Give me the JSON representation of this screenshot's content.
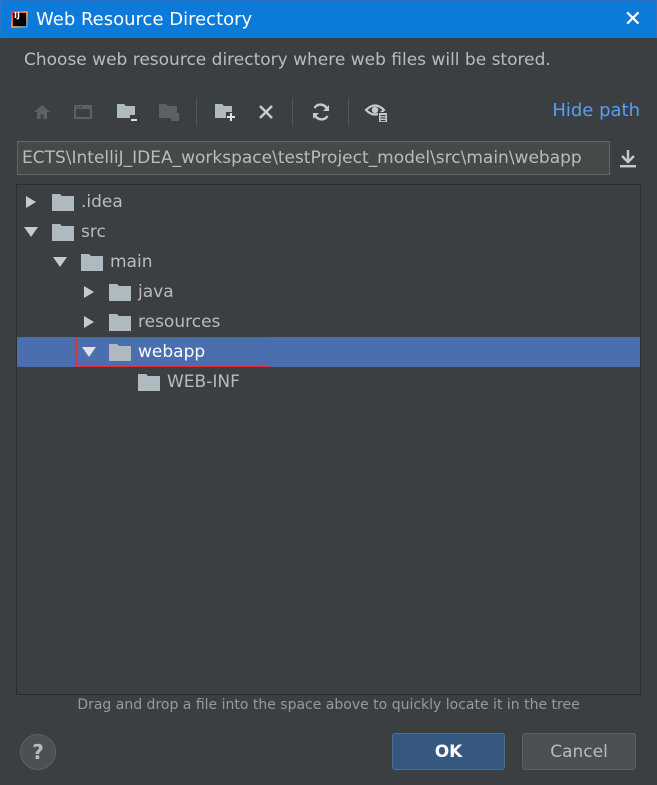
{
  "window": {
    "title": "Web Resource Directory",
    "close_glyph": "✕",
    "app_icon": "intellij-idea-icon"
  },
  "description": "Choose web resource directory where web files will be stored.",
  "toolbar": {
    "buttons": [
      {
        "name": "home-icon",
        "enabled": false
      },
      {
        "name": "desktop-icon",
        "enabled": false
      },
      {
        "name": "project-folder-icon",
        "enabled": true
      },
      {
        "name": "module-folder-icon",
        "enabled": false
      },
      {
        "name": "new-folder-icon",
        "enabled": true
      },
      {
        "name": "delete-icon",
        "enabled": true
      },
      {
        "name": "refresh-icon",
        "enabled": true
      },
      {
        "name": "show-hidden-icon",
        "enabled": true
      }
    ],
    "hide_path_label": "Hide path"
  },
  "path": {
    "value": "ECTS\\IntelliJ_IDEA_workspace\\testProject_model\\src\\main\\webapp"
  },
  "tree": {
    "items": [
      {
        "label": ".idea",
        "expanded": false,
        "has_children": true,
        "selected": false
      },
      {
        "label": "src",
        "expanded": true,
        "has_children": true,
        "selected": false
      },
      {
        "label": "main",
        "expanded": true,
        "has_children": true,
        "selected": false
      },
      {
        "label": "java",
        "expanded": false,
        "has_children": true,
        "selected": false
      },
      {
        "label": "resources",
        "expanded": false,
        "has_children": true,
        "selected": false
      },
      {
        "label": "webapp",
        "expanded": true,
        "has_children": true,
        "selected": true
      },
      {
        "label": "WEB-INF",
        "expanded": false,
        "has_children": false,
        "selected": false
      }
    ]
  },
  "hint": "Drag and drop a file into the space above to quickly locate it in the tree",
  "buttons": {
    "help": "?",
    "ok": "OK",
    "cancel": "Cancel"
  },
  "colors": {
    "background": "#3c3f41",
    "titlebar": "#0c7ad8",
    "selection": "#4b6eaf",
    "link": "#589df6",
    "folder": "#aeb9c0",
    "highlight": "#e0303a"
  }
}
